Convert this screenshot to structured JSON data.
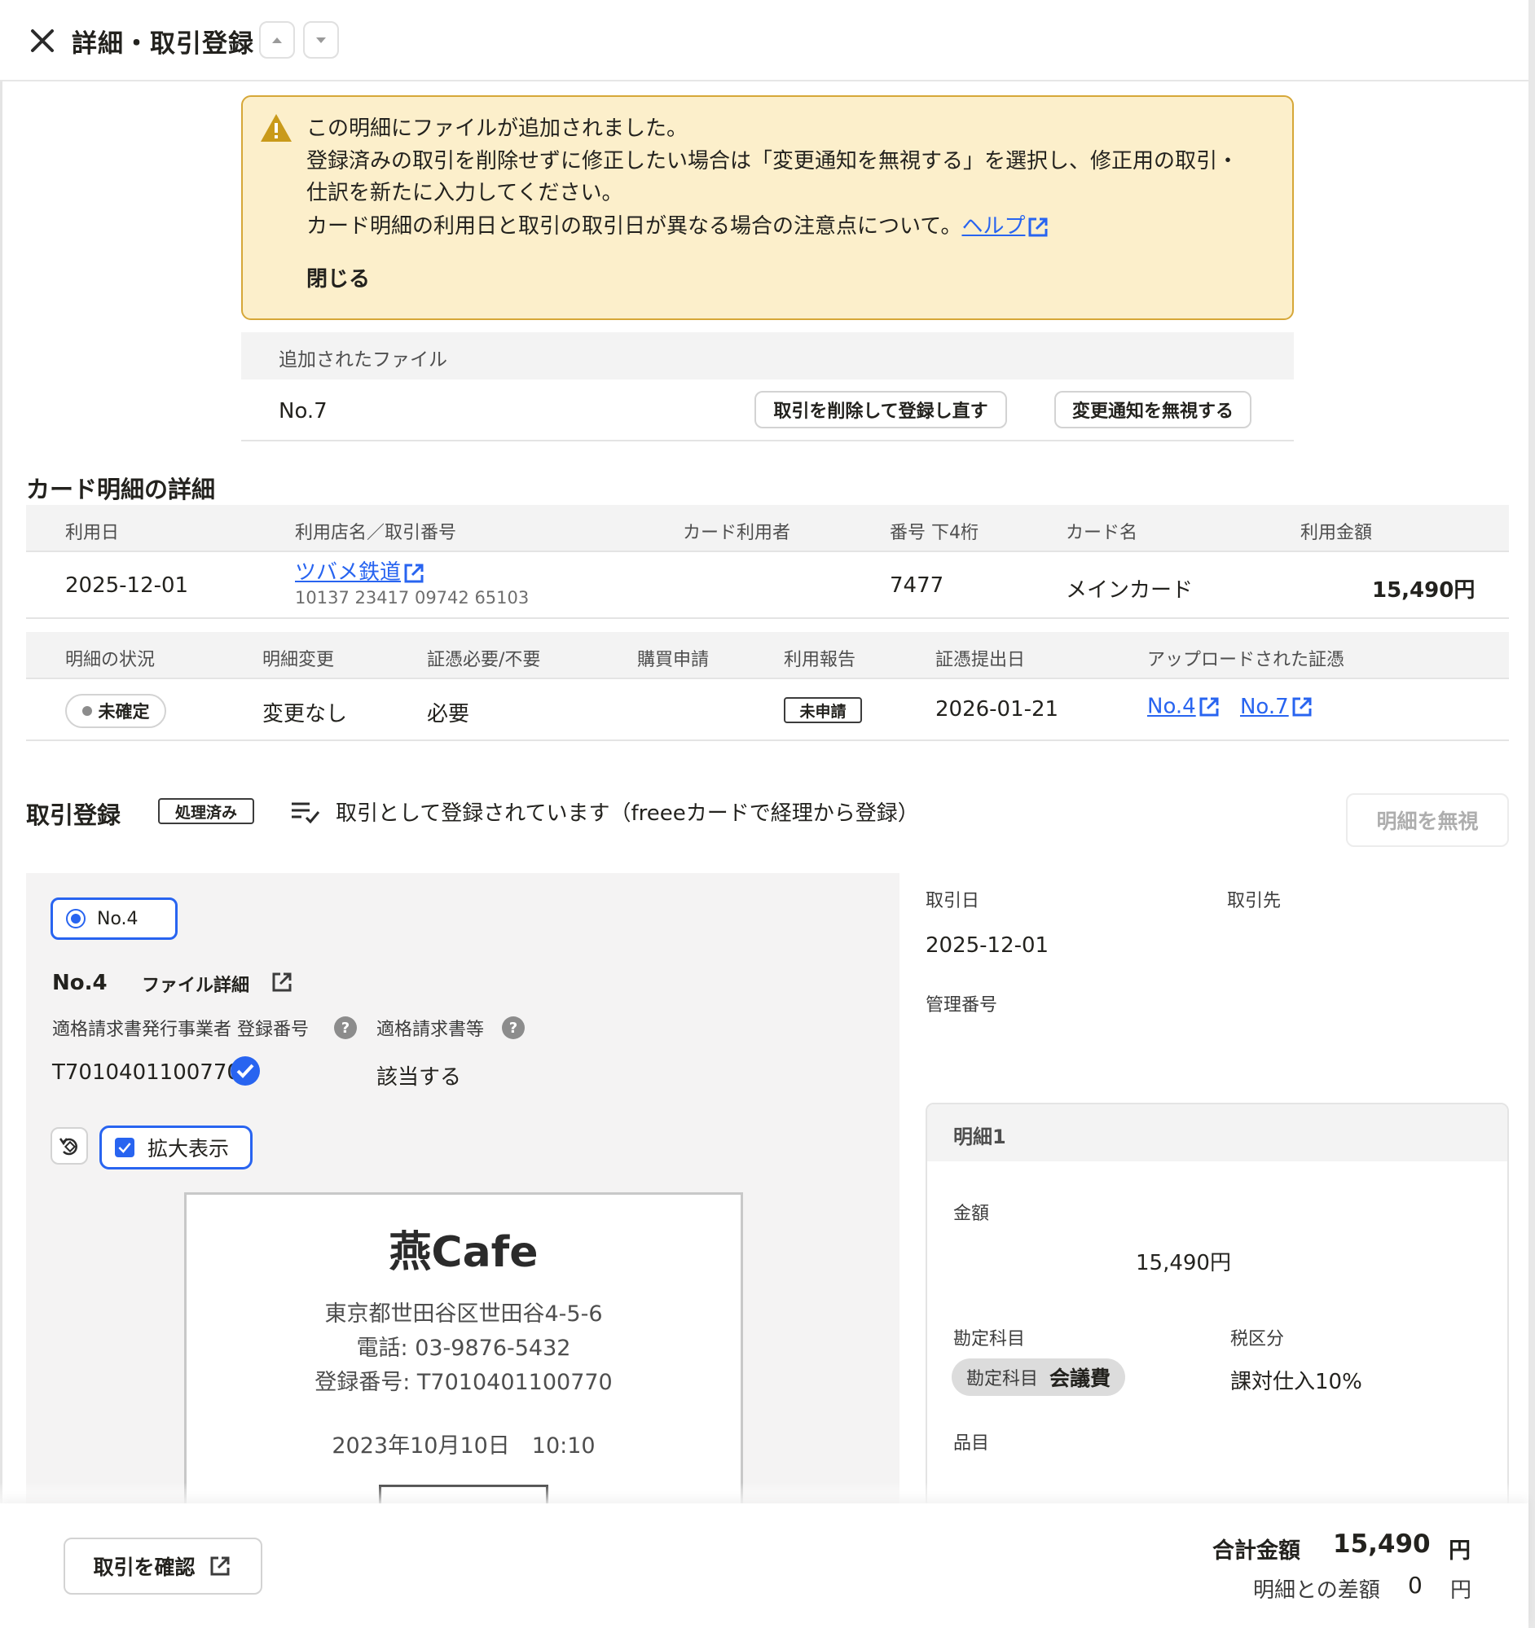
{
  "header": {
    "title": "詳細・取引登録"
  },
  "notice": {
    "line1": "この明細にファイルが追加されました。",
    "line2": "登録済みの取引を削除せずに修正したい場合は「変更通知を無視する」を選択し、修正用の取引・",
    "line3": "仕訳を新たに入力してください。",
    "line4": "カード明細の利用日と取引の取引日が異なる場合の注意点について。",
    "help_link": "ヘルプ",
    "close_label": "閉じる"
  },
  "added_files": {
    "header": "追加されたファイル",
    "file_no": "No.7",
    "delete_button": "取引を削除して登録し直す",
    "ignore_button": "変更通知を無視する"
  },
  "card_detail": {
    "title": "カード明細の詳細",
    "columns": [
      "利用日",
      "利用店名／取引番号",
      "カード利用者",
      "番号 下4桁",
      "カード名",
      "利用金額"
    ],
    "row": {
      "date": "2025-12-01",
      "store": "ツバメ鉄道",
      "txn_number": "10137 23417 09742 65103",
      "user": "",
      "last4": "7477",
      "card_name": "メインカード",
      "amount": "15,490円"
    },
    "columns2": [
      "明細の状況",
      "明細変更",
      "証憑必要/不要",
      "購買申請",
      "利用報告",
      "証憑提出日",
      "アップロードされた証憑"
    ],
    "row2": {
      "status": "未確定",
      "change": "変更なし",
      "evidence_required": "必要",
      "purchase_request": "",
      "usage_report": "未申請",
      "submit_date": "2026-01-21",
      "evidence1": "No.4",
      "evidence2": "No.7"
    }
  },
  "registration": {
    "title": "取引登録",
    "badge": "処理済み",
    "status_text": "取引として登録されています（freeeカードで経理から登録）",
    "ignore_button": "明細を無視"
  },
  "preview": {
    "radio_label": "No.4",
    "file_no": "No.4",
    "file_detail": "ファイル詳細",
    "invoice_issuer_label": "適格請求書発行事業者 登録番号",
    "invoice_qualified_label": "適格請求書等",
    "help_glyph": "?",
    "invoice_number": "T7010401100770",
    "invoice_qualified_value": "該当する",
    "zoom_label": "拡大表示",
    "receipt": {
      "title": "燕Cafe",
      "address": "東京都世田谷区世田谷4-5-6",
      "tel": "電話: 03-9876-5432",
      "reg": "登録番号: T7010401100770",
      "datetime": "2023年10月10日　10:10"
    }
  },
  "form": {
    "deal_date_label": "取引日",
    "partner_label": "取引先",
    "deal_date": "2025-12-01",
    "mgmt_label": "管理番号",
    "detail": {
      "title": "明細1",
      "amount_label": "金額",
      "amount_value": "15,490円",
      "account_label": "勘定科目",
      "tax_label": "税区分",
      "account_chip_key": "勘定科目",
      "account_chip_value": "会議費",
      "tax_value": "課対仕入10%",
      "item_label": "品目"
    }
  },
  "footer": {
    "confirm_button": "取引を確認",
    "total_label": "合計金額",
    "total_value": "15,490",
    "total_unit": "円",
    "diff_label": "明細との差額",
    "diff_value": "0",
    "diff_unit": "円"
  },
  "colors": {
    "link": "#2864f0",
    "notice_bg": "#fcefcb",
    "notice_border": "#d6a738",
    "warning": "#c99a1a"
  }
}
